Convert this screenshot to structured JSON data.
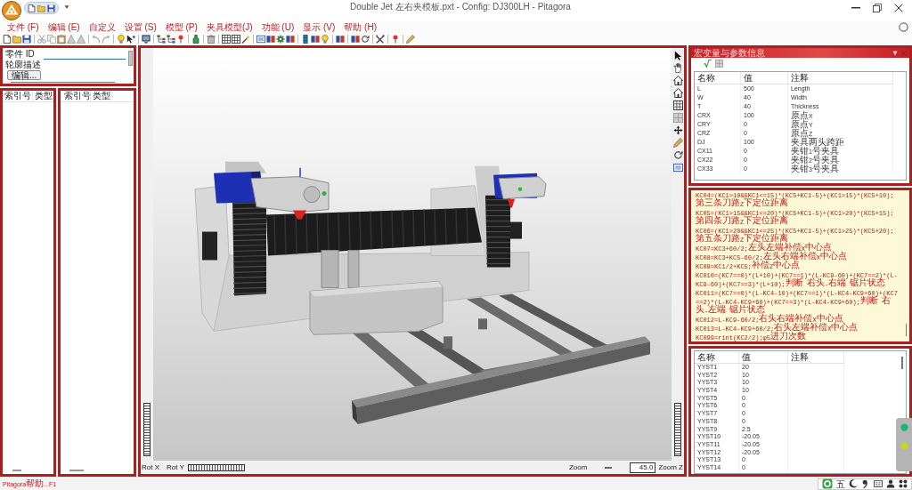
{
  "window": {
    "title": "Double Jet 左右夹模板.pxt - Config: DJ300LH - Pitagora"
  },
  "menu": [
    {
      "label": "文件 (F)"
    },
    {
      "label": "编辑 (E)"
    },
    {
      "label": "自定义"
    },
    {
      "label": "设置 (S)"
    },
    {
      "label": "模型 (P)"
    },
    {
      "label": "夹具模型(J)"
    },
    {
      "label": "功能 (U)"
    },
    {
      "label": "显示 (V)"
    },
    {
      "label": "帮助 (H)"
    }
  ],
  "part_panel": {
    "id_label": "零件 ID",
    "description_label": "轮廓描述",
    "edit_button": "编辑..."
  },
  "left_list": {
    "columns": [
      "索引号",
      "类型"
    ]
  },
  "middle_list": {
    "columns": [
      "索引号",
      "类型"
    ]
  },
  "viewport": {
    "rot_x_label": "Rot X",
    "rot_y_label": "Rot Y",
    "zoom_label": "Zoom",
    "zoom_value": "45.0",
    "zoom_z_label": "Zoom Z"
  },
  "parameters_panel": {
    "title": "宏变量与参数信息",
    "columns": [
      "名称",
      "值",
      "注释"
    ],
    "rows": [
      {
        "name": "L",
        "value": "500",
        "comment": "Length"
      },
      {
        "name": "W",
        "value": "40",
        "comment": "Width"
      },
      {
        "name": "T",
        "value": "40",
        "comment": "Thickness"
      },
      {
        "name": "CRX",
        "value": "100",
        "comment": "原点X"
      },
      {
        "name": "CRY",
        "value": "0",
        "comment": "原点Y"
      },
      {
        "name": "CRZ",
        "value": "0",
        "comment": "原点Z"
      },
      {
        "name": "DJ",
        "value": "100",
        "comment": "夹具两头跨距"
      },
      {
        "name": "CX11",
        "value": "0",
        "comment": "夹钳1号夹具"
      },
      {
        "name": "CX22",
        "value": "0",
        "comment": "夹钳2号夹具"
      },
      {
        "name": "CX33",
        "value": "0",
        "comment": "夹钳3号夹具"
      }
    ]
  },
  "macro_panel": {
    "lines": [
      "KC04=(KC1>10&&KC1<=15)*(KC5+KC1-5)+(KC1>15)*(KC5+10);第三条刀路Z下定位距离",
      "KC05=(KC1>15&&KC1<=20)*(KC5+KC1-5)+(KC1>20)*(KC5+15);第四条刀路Z下定位距离",
      "KC06=(KC1>20&&KC1<=25)*(KC5+KC1-5)+(KC1>25)*(KC5+20);第五条刀路Z下定位距离",
      "KC07=KC3+60/2;左头左端补偿X中心点",
      "KC08=KC3+KC5-60/2;左头右端补偿X中心点",
      "KC09=KC1/2+KC5;补偿Z中心点",
      "KC010=(KC7==0)*(L+10)+(KC7==1)*(L-KC9-60)+(KC7==2)*(L-KC9-60)+(KC7==3)*(L+10);判断 右头-右端 锯片状态",
      "KC011=(KC7==0)*(L-KC4-10)+(KC7==1)*(L-KC4-KC9+60)+(KC7==2)*(L-KC4-KC9+60)+(KC7==3)*(L-KC4-KC9+60);判断 右头-左端 锯片状态",
      "KC012=L-KC9-60/2;右头右端补偿X中心点",
      "KC013=L-KC4-KC9+60/2;右头左端补偿X中心点",
      "KC099=rint(KC2/2);φ5进刀次数"
    ]
  },
  "variables_panel": {
    "columns": [
      "名称",
      "值",
      "注释"
    ],
    "rows": [
      {
        "name": "YYST1",
        "value": "20"
      },
      {
        "name": "YYST2",
        "value": "10"
      },
      {
        "name": "YYST3",
        "value": "10"
      },
      {
        "name": "YYST4",
        "value": "10"
      },
      {
        "name": "YYST5",
        "value": "0"
      },
      {
        "name": "YYST6",
        "value": "0"
      },
      {
        "name": "YYST7",
        "value": "0"
      },
      {
        "name": "YYST8",
        "value": "0"
      },
      {
        "name": "YYST9",
        "value": "2.5"
      },
      {
        "name": "YYST10",
        "value": "-20.05"
      },
      {
        "name": "YYST11",
        "value": "-20.05"
      },
      {
        "name": "YYST12",
        "value": "-20.05"
      },
      {
        "name": "YYST13",
        "value": "0"
      },
      {
        "name": "YYST14",
        "value": "0"
      }
    ]
  },
  "status_bar": {
    "text": "Pitagora帮助...F1"
  },
  "ime_bar": {
    "mode": "五"
  }
}
